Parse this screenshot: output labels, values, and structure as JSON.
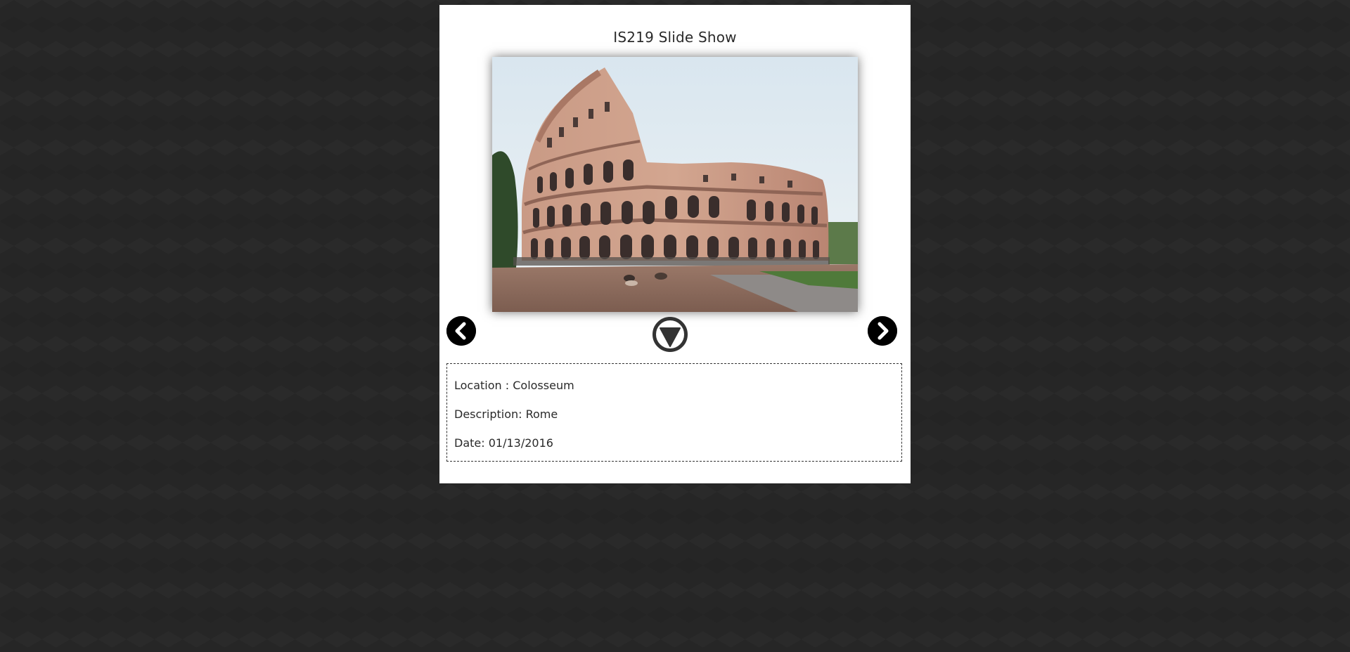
{
  "slideshow": {
    "title": "IS219 Slide Show",
    "image": {
      "subject": "Colosseum"
    },
    "controls": {
      "prev_icon": "chevron-left-icon",
      "next_icon": "chevron-right-icon",
      "toggle_icon": "triangle-down-icon"
    },
    "details": {
      "location": "Location : Colosseum",
      "description": "Description: Rome",
      "date": "Date: 01/13/2016"
    }
  },
  "colors": {
    "background": "#262626",
    "panel": "#ffffff",
    "button": "#000000",
    "play_button": "#333333"
  }
}
